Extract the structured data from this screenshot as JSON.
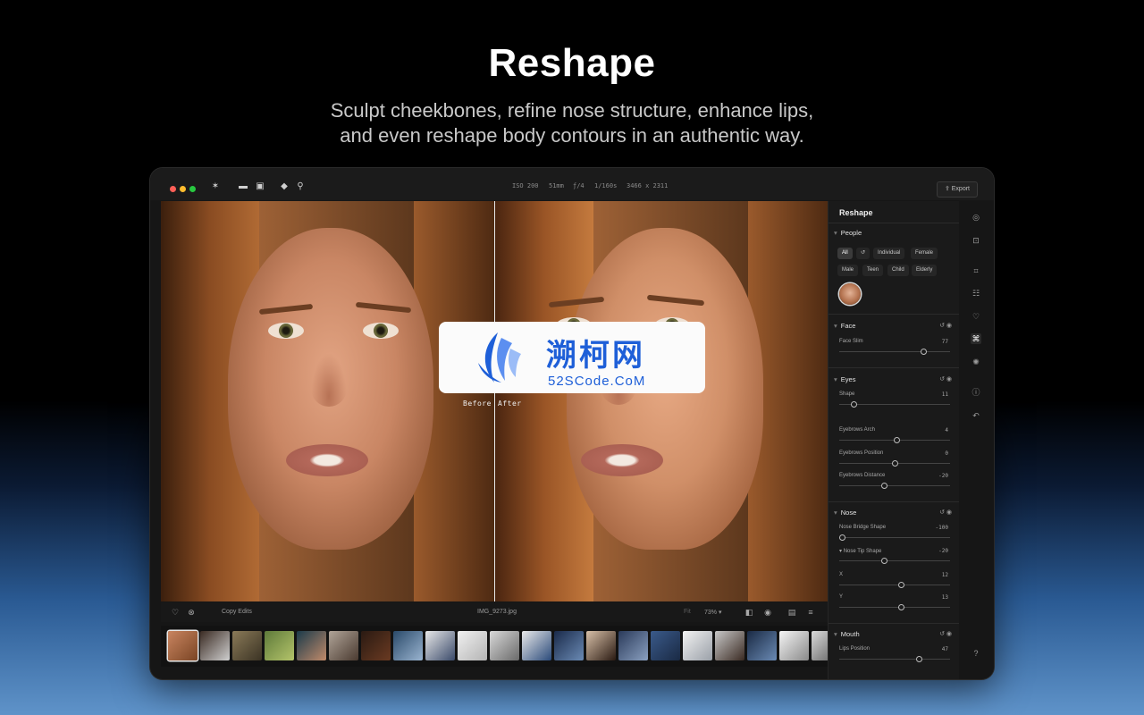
{
  "hero": {
    "title": "Reshape",
    "subtitle_line1": "Sculpt cheekbones, refine nose structure, enhance lips,",
    "subtitle_line2": "and even reshape body contours in an authentic way."
  },
  "titlebar": {
    "meta": [
      "ISO 200",
      "51mm",
      "ƒ/4",
      "1/160s",
      "3466 x 2311"
    ],
    "export_label": "Export"
  },
  "canvas": {
    "before_label": "Before",
    "after_label": "After"
  },
  "bottombar": {
    "copy_edits": "Copy Edits",
    "filename": "IMG_9273.jpg",
    "zoom": "73%",
    "fit": "Fit"
  },
  "panel": {
    "title": "Reshape",
    "people": {
      "title": "People",
      "chips_row1": [
        "All",
        "Individual",
        "Female"
      ],
      "chips_row2": [
        "Male",
        "Teen",
        "Child",
        "Elderly"
      ]
    },
    "face": {
      "title": "Face",
      "sliders": [
        {
          "label": "Face Slim",
          "value": "77",
          "fraction": 0.77
        }
      ]
    },
    "eyes": {
      "title": "Eyes",
      "sliders": [
        {
          "label": "Shape",
          "value": "11",
          "fraction": 0.11
        },
        {
          "label": "Eyebrows Arch",
          "value": "4",
          "fraction": 0.52
        },
        {
          "label": "Eyebrows Position",
          "value": "0",
          "fraction": 0.5
        },
        {
          "label": "Eyebrows Distance",
          "value": "-20",
          "fraction": 0.4
        }
      ]
    },
    "nose": {
      "title": "Nose",
      "sliders": [
        {
          "label": "Nose Bridge Shape",
          "value": "-100",
          "fraction": 0.0
        },
        {
          "label": "Nose Tip Shape",
          "value": "-20",
          "fraction": 0.4
        },
        {
          "label": "X",
          "value": "12",
          "fraction": 0.56
        },
        {
          "label": "Y",
          "value": "13",
          "fraction": 0.56
        }
      ]
    },
    "mouth": {
      "title": "Mouth",
      "sliders": [
        {
          "label": "Lips Position",
          "value": "47",
          "fraction": 0.73
        }
      ]
    }
  },
  "watermark": {
    "cn": "溯柯网",
    "en": "52SCode.CoM"
  },
  "colors": {
    "accent_blue": "#1e5fd8",
    "traffic_red": "#ff5f57",
    "traffic_yellow": "#febc2e",
    "traffic_green": "#28c840"
  },
  "icons": {
    "rail": [
      "layers-icon",
      "mask-icon",
      "crop-icon",
      "adjust-icon",
      "portrait-icon",
      "reshape-icon",
      "sparkle-icon",
      "info-icon",
      "history-icon",
      "help-icon"
    ]
  }
}
